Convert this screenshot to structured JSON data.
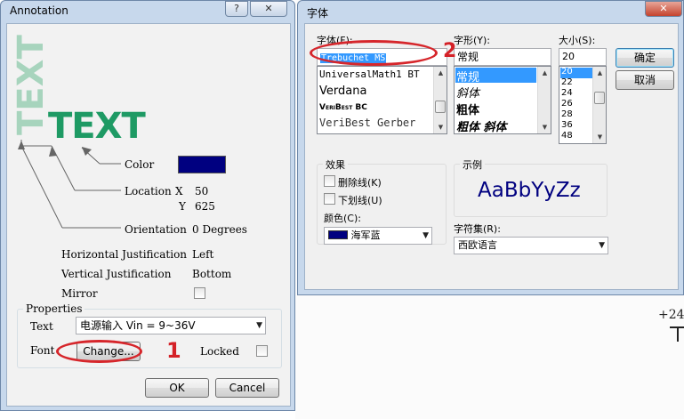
{
  "annotation": {
    "title": "Annotation",
    "help_btn": "?",
    "close_btn": "✕",
    "preview": {
      "vertical_text": "TEXT",
      "main_text": "TEXT"
    },
    "color_label": "Color",
    "color_swatch": "#000080",
    "location_label": "Location",
    "x_label": "X",
    "x_value": "50",
    "y_label": "Y",
    "y_value": "625",
    "orientation_label": "Orientation",
    "orientation_value": "0 Degrees",
    "hjust_label": "Horizontal Justification",
    "hjust_value": "Left",
    "vjust_label": "Vertical Justification",
    "vjust_value": "Bottom",
    "mirror_label": "Mirror",
    "properties_label": "Properties",
    "text_label": "Text",
    "text_value": "电源输入 Vin = 9~36V",
    "font_label": "Font",
    "change_btn": "Change...",
    "locked_label": "Locked",
    "ok_btn": "OK",
    "cancel_btn": "Cancel",
    "marker": "1"
  },
  "font_dialog": {
    "title": "字体",
    "close_btn": "✕",
    "font_label": "字体(F):",
    "font_value": "Trebuchet MS",
    "font_list": [
      "UniversalMath1 BT",
      "Verdana",
      "VeriBest BC",
      "VeriBest Gerber"
    ],
    "style_label": "字形(Y):",
    "style_value": "常规",
    "style_list": [
      "常规",
      "斜体",
      "粗体",
      "粗体 斜体"
    ],
    "size_label": "大小(S):",
    "size_value": "20",
    "size_list": [
      "20",
      "22",
      "24",
      "26",
      "28",
      "36",
      "48"
    ],
    "ok_btn": "确定",
    "cancel_btn": "取消",
    "effects_label": "效果",
    "strike_label": "删除线(K)",
    "underline_label": "下划线(U)",
    "color_label": "颜色(C):",
    "color_value": "海军蓝",
    "color_swatch": "#000080",
    "sample_label": "示例",
    "sample_text": "AaBbYyZz",
    "charset_label": "字符集(R):",
    "charset_value": "西欧语言",
    "marker": "2"
  },
  "background": {
    "annotation_text": "+24"
  },
  "colors": {
    "accent_green": "#1e9a64",
    "select_blue": "#3399ff",
    "marker_red": "#d42127"
  }
}
